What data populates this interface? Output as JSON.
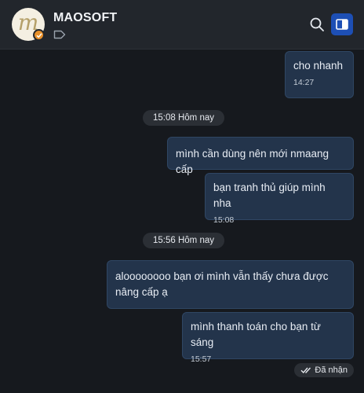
{
  "header": {
    "title": "MAOSOFT",
    "avatar_letter": "m",
    "accent_color": "#1d4fb5",
    "verified_color": "#e8912c",
    "icons": [
      "tag-icon",
      "search-icon",
      "side-panel-icon"
    ]
  },
  "messages": [
    {
      "text": "cho nhanh",
      "time": "14:27"
    },
    {
      "text": "mình cần dùng nên mới nmaang cấp",
      "time": ""
    },
    {
      "text": "bạn tranh thủ giúp mình nha",
      "time": "15:08"
    },
    {
      "text": "aloooooooo bạn ơi mình vẫn thấy chưa được nâng cấp ạ",
      "time": ""
    },
    {
      "text": "mình thanh toán cho bạn từ sáng",
      "time": "15:57"
    }
  ],
  "dividers": [
    "15:08 Hôm nay",
    "15:56 Hôm nay"
  ],
  "status": {
    "label": "Đã nhận"
  }
}
